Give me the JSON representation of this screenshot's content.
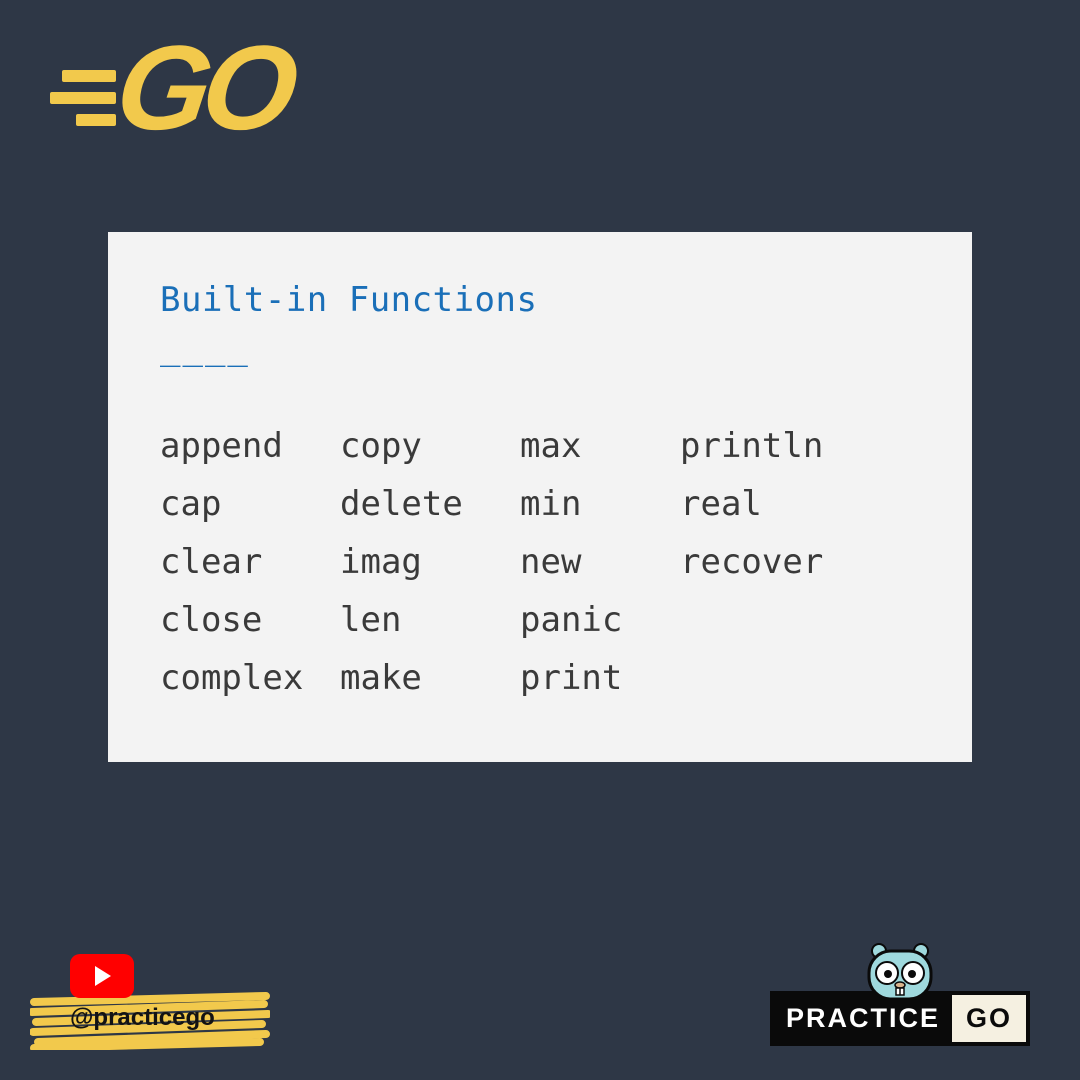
{
  "logo": {
    "text": "GO"
  },
  "card": {
    "title": "Built-in Functions",
    "underline": "____",
    "functions": {
      "col1": [
        "append",
        "cap",
        "clear",
        "close",
        "complex"
      ],
      "col2": [
        "copy",
        "delete",
        "imag",
        "len",
        "make"
      ],
      "col3": [
        "max",
        "min",
        "new",
        "panic",
        "print"
      ],
      "col4": [
        "println",
        "real",
        "recover",
        "",
        ""
      ]
    }
  },
  "footer": {
    "handle": "@practicego",
    "brand_practice": "PRACTICE",
    "brand_go": "GO"
  }
}
